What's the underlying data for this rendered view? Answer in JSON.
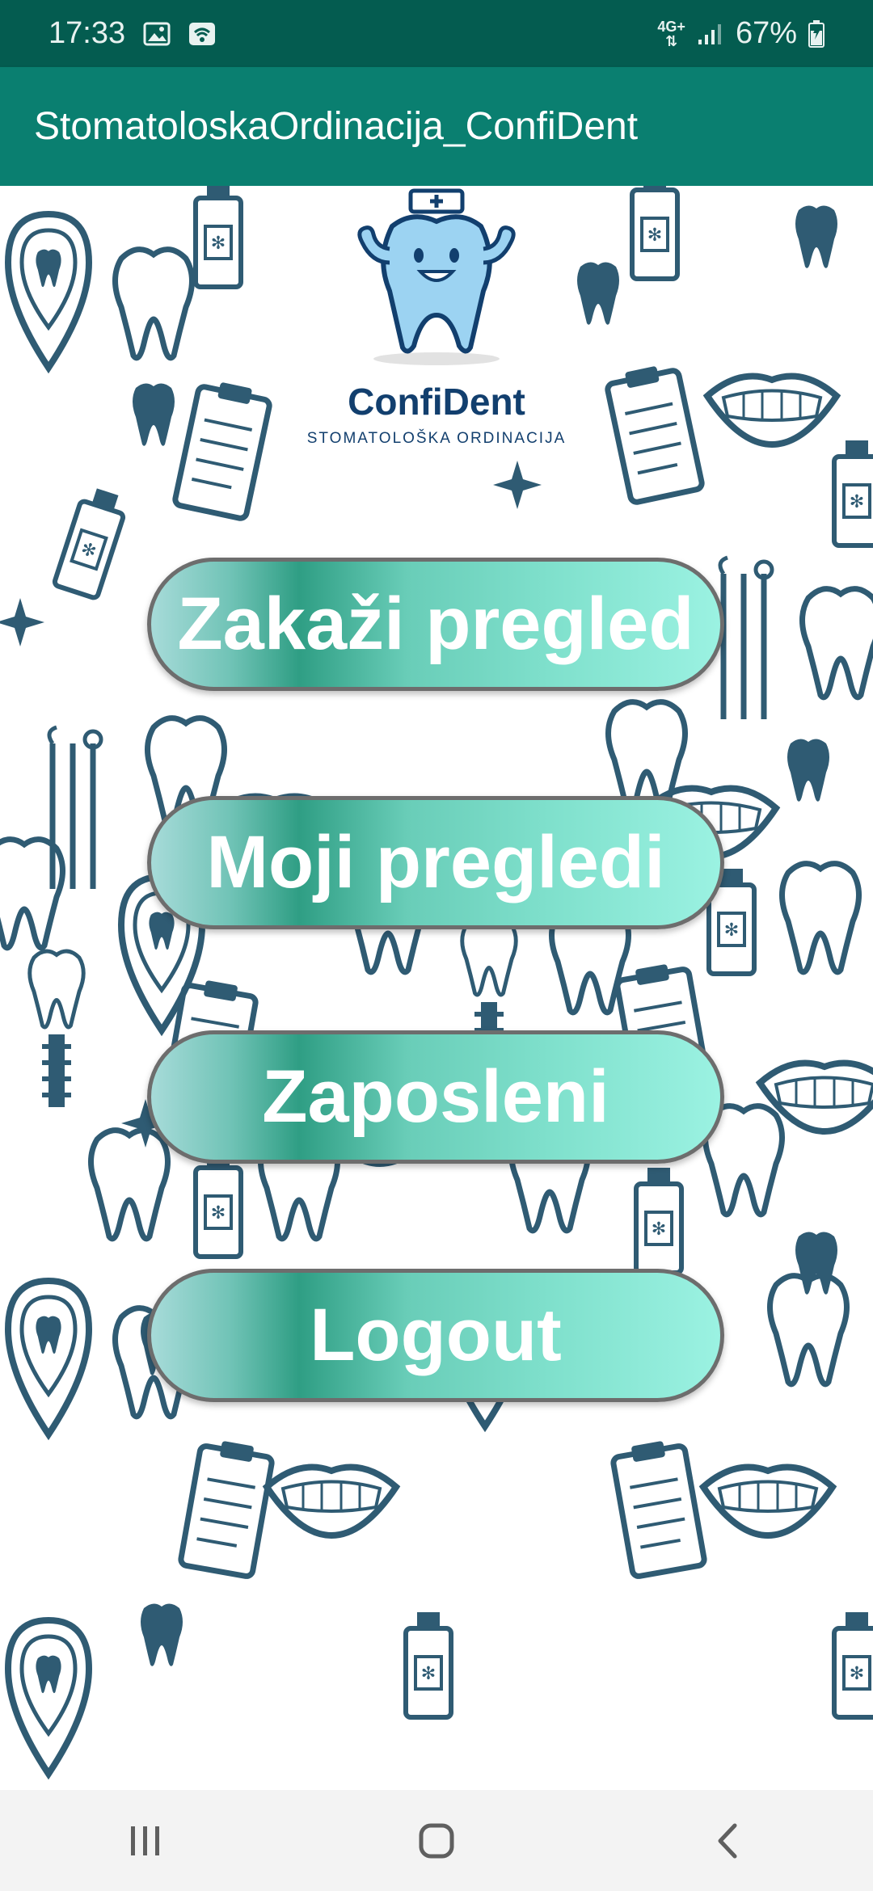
{
  "status_bar": {
    "time": "17:33",
    "network_label_top": "4G+",
    "battery_percent": "67%",
    "icons": [
      "image-icon",
      "wifi-icon",
      "network-arrows-icon",
      "signal-icon",
      "battery-charging-icon"
    ]
  },
  "app_bar": {
    "title": "StomatoloskaOrdinacija_ConfiDent"
  },
  "logo": {
    "title": "ConfiDent",
    "subtitle": "STOMATOLOŠKA ORDINACIJA"
  },
  "menu": {
    "buttons": [
      {
        "label": "Zakaži pregled"
      },
      {
        "label": "Moji pregledi"
      },
      {
        "label": "Zaposleni"
      },
      {
        "label": "Logout"
      }
    ]
  },
  "nav_bar": {
    "icons": [
      "recent-apps-icon",
      "home-icon",
      "back-icon"
    ]
  },
  "colors": {
    "status_bar": "#045c50",
    "app_bar": "#0a7f70",
    "pattern": "#2f5b73",
    "button_border": "#6d6d6d",
    "logo_text": "#123f6e"
  }
}
